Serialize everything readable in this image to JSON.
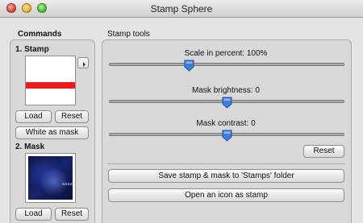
{
  "window": {
    "title": "Stamp Sphere"
  },
  "commands": {
    "header": "Commands",
    "stamp": {
      "label": "1. Stamp",
      "load": "Load",
      "reset": "Reset",
      "white_as_mask": "White as mask"
    },
    "mask": {
      "label": "2. Mask",
      "load": "Load",
      "reset": "Reset",
      "image_text": "aaaaaaaa"
    }
  },
  "tools": {
    "header": "Stamp tools",
    "scale": {
      "label": "Scale in percent: 100%",
      "level": 0.34
    },
    "brightness": {
      "label": "Mask brightness: 0",
      "level": 0.5
    },
    "contrast": {
      "label": "Mask contrast: 0",
      "level": 0.5
    },
    "reset": "Reset",
    "save": "Save stamp & mask to 'Stamps' folder",
    "open_icon": "Open an icon as stamp"
  },
  "colors": {
    "stamp_bar": "#ec1b1b",
    "thumb": "#3a7fe3"
  }
}
